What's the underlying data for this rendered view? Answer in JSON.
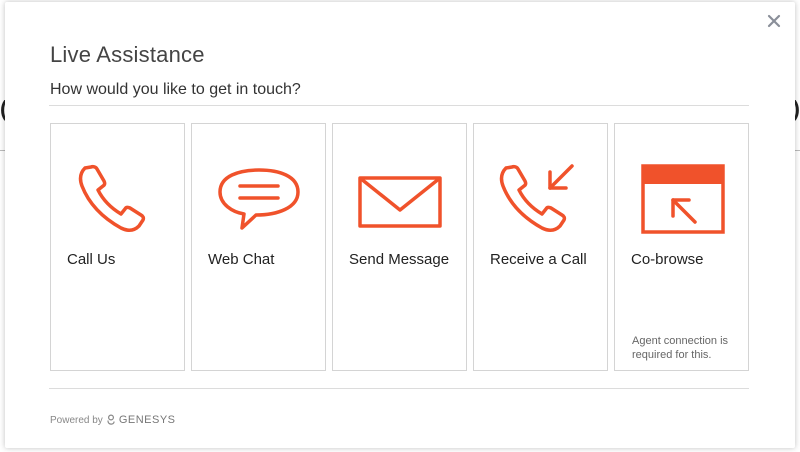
{
  "modal": {
    "title": "Live Assistance",
    "subtitle": "How would you like to get in touch?",
    "close_icon": "close-icon"
  },
  "options": [
    {
      "label": "Call Us",
      "icon": "phone-icon"
    },
    {
      "label": "Web Chat",
      "icon": "chat-bubble-icon"
    },
    {
      "label": "Send Message",
      "icon": "envelope-icon"
    },
    {
      "label": "Receive a Call",
      "icon": "incoming-call-icon"
    },
    {
      "label": "Co-browse",
      "icon": "cobrowse-window-icon",
      "note": "Agent connection is required for this."
    }
  ],
  "footer": {
    "powered_by": "Powered by",
    "brand": "GENESYS"
  },
  "colors": {
    "accent": "#f0522b",
    "text": "#222222",
    "border": "#d4d4d4"
  }
}
